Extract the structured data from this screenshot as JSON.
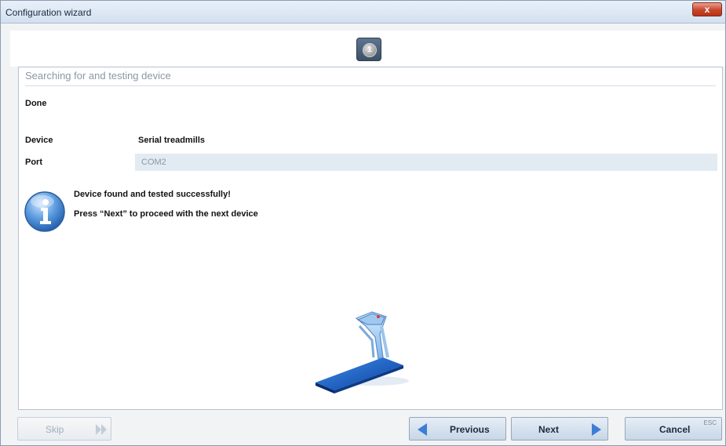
{
  "window": {
    "title": "Configuration wizard",
    "close_glyph": "x"
  },
  "steps": {
    "current": "1"
  },
  "section": {
    "heading": "Searching for and testing device",
    "status": "Done",
    "device_label": "Device",
    "device_value": "Serial treadmills",
    "port_label": "Port",
    "port_value": "COM2"
  },
  "message": {
    "line1": "Device found and tested successfully!",
    "line2": "Press “Next” to proceed with the next device",
    "icon": "info-icon"
  },
  "buttons": {
    "skip": "Skip",
    "previous": "Previous",
    "next": "Next",
    "cancel": "Cancel",
    "cancel_shortcut": "ESC"
  },
  "colors": {
    "accent": "#3a7fd5",
    "panel": "#e3ebf2"
  }
}
